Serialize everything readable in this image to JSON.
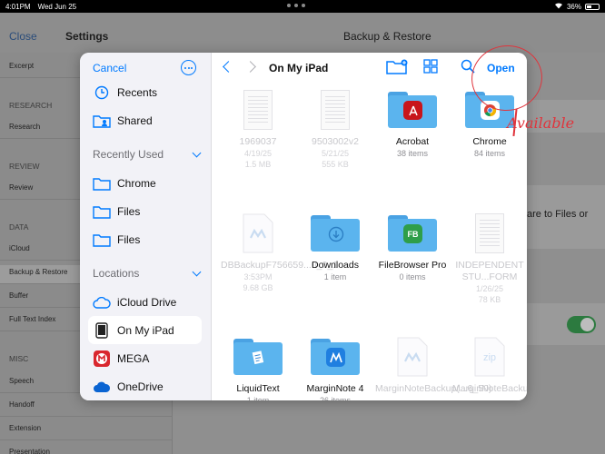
{
  "status_bar": {
    "time": "4:01PM",
    "date": "Wed Jun 25",
    "battery": "36%"
  },
  "background": {
    "close": "Close",
    "settings_title": "Settings",
    "detail_title": "Backup & Restore",
    "right_text": "are to Files or",
    "sidebar": [
      {
        "label": "Excerpt",
        "type": "row"
      },
      {
        "label": "RESEARCH",
        "type": "section"
      },
      {
        "label": "Research",
        "type": "row"
      },
      {
        "label": "REVIEW",
        "type": "section"
      },
      {
        "label": "Review",
        "type": "row"
      },
      {
        "label": "DATA",
        "type": "section"
      },
      {
        "label": "iCloud",
        "type": "row"
      },
      {
        "label": "Backup & Restore",
        "type": "row"
      },
      {
        "label": "Buffer",
        "type": "row"
      },
      {
        "label": "Full Text Index",
        "type": "row"
      },
      {
        "label": "MISC",
        "type": "section"
      },
      {
        "label": "Speech",
        "type": "row"
      },
      {
        "label": "Handoff",
        "type": "row"
      },
      {
        "label": "Extension",
        "type": "row"
      },
      {
        "label": "Presentation",
        "type": "row"
      }
    ]
  },
  "picker": {
    "cancel": "Cancel",
    "sidebar": {
      "recents": "Recents",
      "shared": "Shared",
      "recently_used_header": "Recently Used",
      "recently_used": [
        "Chrome",
        "Files",
        "Files"
      ],
      "locations_header": "Locations",
      "locations": [
        "iCloud Drive",
        "On My iPad",
        "MEGA",
        "OneDrive"
      ]
    },
    "location_title": "On My iPad",
    "open": "Open",
    "items": [
      {
        "name": "1969037",
        "meta1": "4/19/25",
        "meta2": "1.5 MB",
        "kind": "doc",
        "dim": true
      },
      {
        "name": "9503002v2",
        "meta1": "5/21/25",
        "meta2": "555 KB",
        "kind": "doc",
        "dim": true
      },
      {
        "name": "Acrobat",
        "meta1": "38 items",
        "meta2": "",
        "kind": "folder",
        "dim": false
      },
      {
        "name": "Chrome",
        "meta1": "84 items",
        "meta2": "",
        "kind": "folder",
        "dim": false
      },
      {
        "name": "DBBackupF756659...0_0_1",
        "meta1": "3:53PM",
        "meta2": "9.68 GB",
        "kind": "mn-file",
        "dim": true
      },
      {
        "name": "Downloads",
        "meta1": "1 item",
        "meta2": "",
        "kind": "folder",
        "dim": false
      },
      {
        "name": "FileBrowser Pro",
        "meta1": "0 items",
        "meta2": "",
        "kind": "folder",
        "dim": false
      },
      {
        "name": "INDEPENDENT STU...FORM",
        "meta1": "1/26/25",
        "meta2": "78 KB",
        "kind": "doc",
        "dim": true
      },
      {
        "name": "LiquidText",
        "meta1": "1 item",
        "meta2": "",
        "kind": "folder",
        "dim": false
      },
      {
        "name": "MarginNote 4",
        "meta1": "26 items",
        "meta2": "",
        "kind": "folder",
        "dim": false
      },
      {
        "name": "MarginNoteBackup(...6_50)",
        "meta1": "",
        "meta2": "",
        "kind": "mn-file",
        "dim": true
      },
      {
        "name": "MarginNoteBackup(...0).zip",
        "meta1": "",
        "meta2": "",
        "kind": "zip",
        "dim": true
      }
    ]
  },
  "annotation": {
    "text": "Available"
  },
  "colors": {
    "accent": "#007aff",
    "annotation": "#e0343c",
    "folder": "#5bb4ee"
  }
}
